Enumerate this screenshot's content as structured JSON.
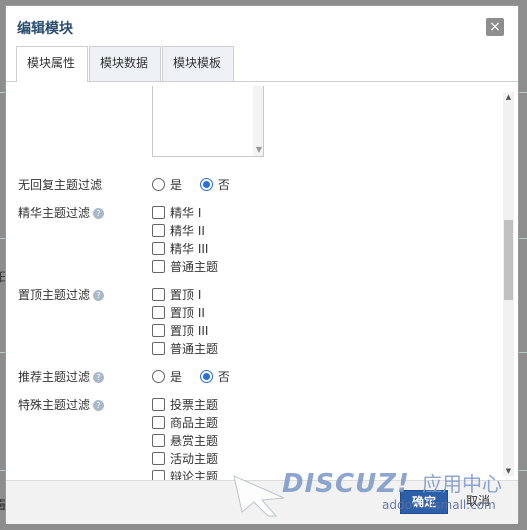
{
  "dialog": {
    "title": "编辑模块",
    "close_label": "×"
  },
  "tabs": [
    {
      "label": "模块属性"
    },
    {
      "label": "模块数据"
    },
    {
      "label": "模块模板"
    }
  ],
  "form": {
    "no_reply_filter": {
      "label": "无回复主题过滤",
      "options": [
        "是",
        "否"
      ],
      "selected": "否"
    },
    "digest_filter": {
      "label": "精华主题过滤",
      "options": [
        "精华 I",
        "精华 II",
        "精华 III",
        "普通主题"
      ]
    },
    "sticky_filter": {
      "label": "置顶主题过滤",
      "options": [
        "置顶 I",
        "置顶 II",
        "置顶 III",
        "普通主题"
      ]
    },
    "recommend_filter": {
      "label": "推荐主题过滤",
      "options": [
        "是",
        "否"
      ],
      "selected": "否"
    },
    "special_filter": {
      "label": "特殊主题过滤",
      "options": [
        "投票主题",
        "商品主题",
        "悬赏主题",
        "活动主题",
        "辩论主题"
      ]
    }
  },
  "footer": {
    "ok_label": "确定",
    "cancel_label": "取消"
  },
  "background": {
    "left_char_1": "日",
    "left_char_2": "量"
  },
  "watermark": {
    "logo": "DISCUZ!",
    "sub": "应用中心",
    "url": "addon.dismall.com"
  },
  "colors": {
    "accent": "#2d5fa8",
    "radio_selected": "#2a6fdb",
    "title": "#2b4e70"
  }
}
